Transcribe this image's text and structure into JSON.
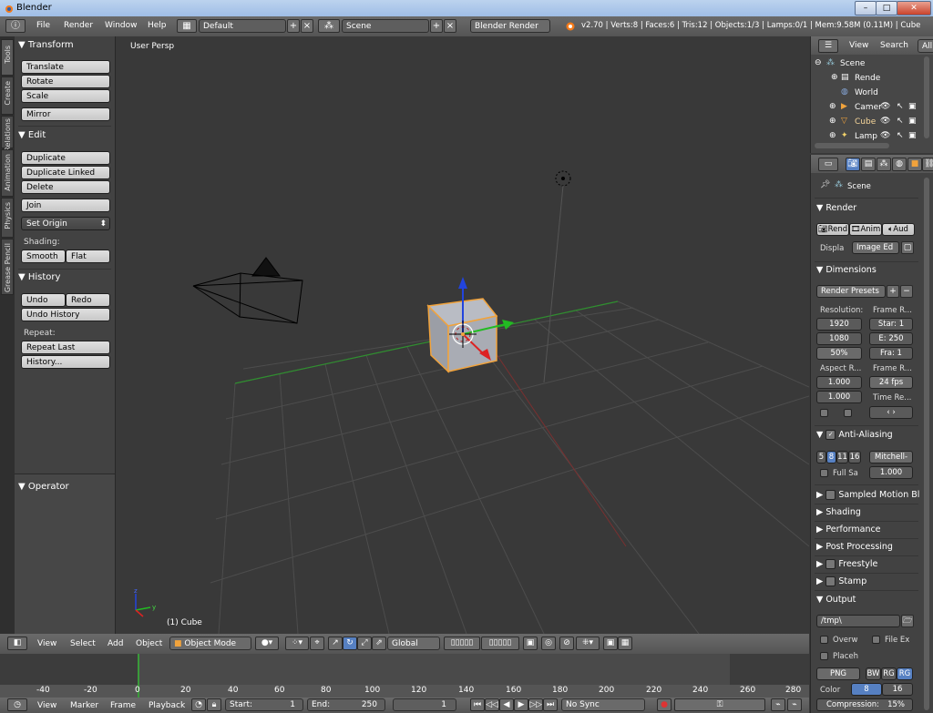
{
  "window": {
    "title": "Blender"
  },
  "topbar": {
    "menus": [
      "File",
      "Render",
      "Window",
      "Help"
    ],
    "screen_layout": "Default",
    "scene": "Scene",
    "engine": "Blender Render",
    "stats": "v2.70 | Verts:8 | Faces:6 | Tris:12 | Objects:1/3 | Lamps:0/1 | Mem:9.58M (0.11M) | Cube"
  },
  "tool_tabs": [
    "Tools",
    "Create",
    "Relations",
    "Animation",
    "Physics",
    "Grease Pencil"
  ],
  "toolshelf": {
    "transform_header": "Transform",
    "translate": "Translate",
    "rotate": "Rotate",
    "scale": "Scale",
    "mirror": "Mirror",
    "edit_header": "Edit",
    "duplicate": "Duplicate",
    "duplicate_linked": "Duplicate Linked",
    "delete": "Delete",
    "join": "Join",
    "set_origin": "Set Origin",
    "shading_label": "Shading:",
    "smooth": "Smooth",
    "flat": "Flat",
    "history_header": "History",
    "undo": "Undo",
    "redo": "Redo",
    "undo_history": "Undo History",
    "repeat_label": "Repeat:",
    "repeat_last": "Repeat Last",
    "history": "History...",
    "operator_header": "Operator"
  },
  "viewport": {
    "view_name": "User Persp",
    "object_label": "(1) Cube"
  },
  "view_header": {
    "menus": [
      "View",
      "Select",
      "Add",
      "Object"
    ],
    "mode": "Object Mode",
    "orientation": "Global"
  },
  "timeline": {
    "ruler": [
      "-40",
      "-20",
      "0",
      "20",
      "40",
      "60",
      "80",
      "100",
      "120",
      "140",
      "160",
      "180",
      "200",
      "220",
      "240",
      "260",
      "280"
    ],
    "menus": [
      "View",
      "Marker",
      "Frame",
      "Playback"
    ],
    "start_label": "Start:",
    "start_value": "1",
    "end_label": "End:",
    "end_value": "250",
    "current_frame": "1",
    "sync": "No Sync"
  },
  "outliner": {
    "menus": [
      "View",
      "Search"
    ],
    "filter": "All",
    "items": [
      "Scene",
      "Rende",
      "World",
      "Camer",
      "Cube",
      "Lamp"
    ]
  },
  "properties": {
    "context": "Scene",
    "render_header": "Render",
    "render_buttons": [
      "Rend",
      "Anim",
      "Aud"
    ],
    "display_label": "Displa",
    "display_value": "Image Ed",
    "dimensions_header": "Dimensions",
    "render_presets": "Render Presets",
    "resolution_label": "Resolution:",
    "res_x": "1920",
    "res_y": "1080",
    "res_pct": "50%",
    "frame_range_label": "Frame R...",
    "frame_start": "Star: 1",
    "frame_end": "E: 250",
    "frame_step": "Fra: 1",
    "aspect_label": "Aspect R...",
    "aspect_x": "1.000",
    "aspect_y": "1.000",
    "frame_rate_label": "Frame R...",
    "fps": "24 fps",
    "time_remap_label": "Time Re...",
    "aa_header": "Anti-Aliasing",
    "aa_samples": [
      "5",
      "8",
      "11",
      "16"
    ],
    "aa_filter": "Mitchell-",
    "full_sample": "Full Sa",
    "filter_size": "1.000",
    "collapsed_panels": [
      "Sampled Motion Bl",
      "Shading",
      "Performance",
      "Post Processing",
      "Freestyle",
      "Stamp"
    ],
    "output_header": "Output",
    "output_path": "/tmp\\",
    "overwrite": "Overw",
    "file_ext": "File Ex",
    "placeholders": "Placeh",
    "format": "PNG",
    "color_modes": [
      "BW",
      "RG",
      "RG"
    ],
    "color_label": "Color",
    "color_depth": [
      "8",
      "16"
    ],
    "compression": "Compression:",
    "compression_value": "15%"
  },
  "colors": {
    "accent_blue": "#5680c2",
    "selection_orange": "#f1a33c",
    "grid_line": "#4a4a4a",
    "x_axis": "#9b3030",
    "y_axis": "#2f8f2f"
  }
}
